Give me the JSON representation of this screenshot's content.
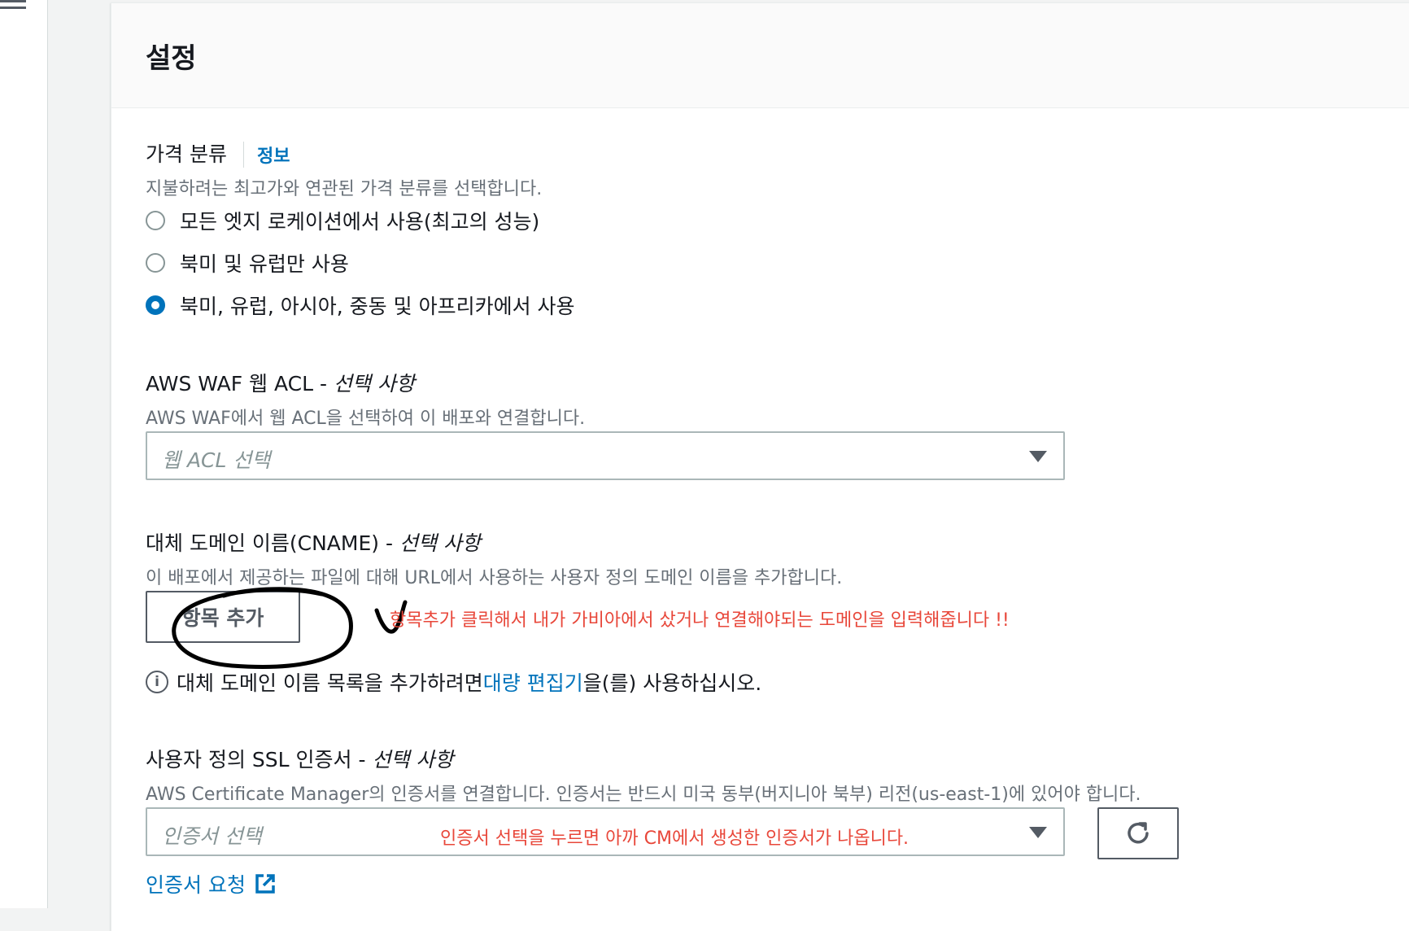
{
  "panel": {
    "title": "설정"
  },
  "price_class": {
    "label": "가격 분류",
    "info": "정보",
    "description": "지불하려는 최고가와 연관된 가격 분류를 선택합니다.",
    "options": [
      {
        "label": "모든 엣지 로케이션에서 사용(최고의 성능)",
        "checked": false
      },
      {
        "label": "북미 및 유럽만 사용",
        "checked": false
      },
      {
        "label": "북미, 유럽, 아시아, 중동 및 아프리카에서 사용",
        "checked": true
      }
    ]
  },
  "waf": {
    "label": "AWS WAF 웹 ACL - ",
    "optional": "선택 사항",
    "description": "AWS WAF에서 웹 ACL을 선택하여 이 배포와 연결합니다.",
    "placeholder": "웹 ACL 선택"
  },
  "cname": {
    "label": "대체 도메인 이름(CNAME) - ",
    "optional": "선택 사항",
    "description": "이 배포에서 제공하는 파일에 대해 URL에서 사용하는 사용자 정의 도메인 이름을 추가합니다.",
    "add_button": "항목 추가",
    "annotation": "항목추가 클릭해서 내가 가비아에서 샀거나 연결해야되는 도메인을 입력해줍니다 !!",
    "info_prefix": "대체 도메인 이름 목록을 추가하려면 ",
    "info_link": "대량 편집기",
    "info_suffix": "을(를) 사용하십시오."
  },
  "ssl": {
    "label": "사용자 정의 SSL 인증서 - ",
    "optional": "선택 사항",
    "description": "AWS Certificate Manager의 인증서를 연결합니다. 인증서는 반드시 미국 동부(버지니아 북부) 리전(us-east-1)에 있어야 합니다.",
    "placeholder": "인증서 선택",
    "annotation": "인증서 선택을 누르면 아까 CM에서 생성한 인증서가 나옵니다.",
    "request_link": "인증서 요청"
  },
  "colors": {
    "accent": "#0073bb",
    "annotation": "#e8473a"
  }
}
